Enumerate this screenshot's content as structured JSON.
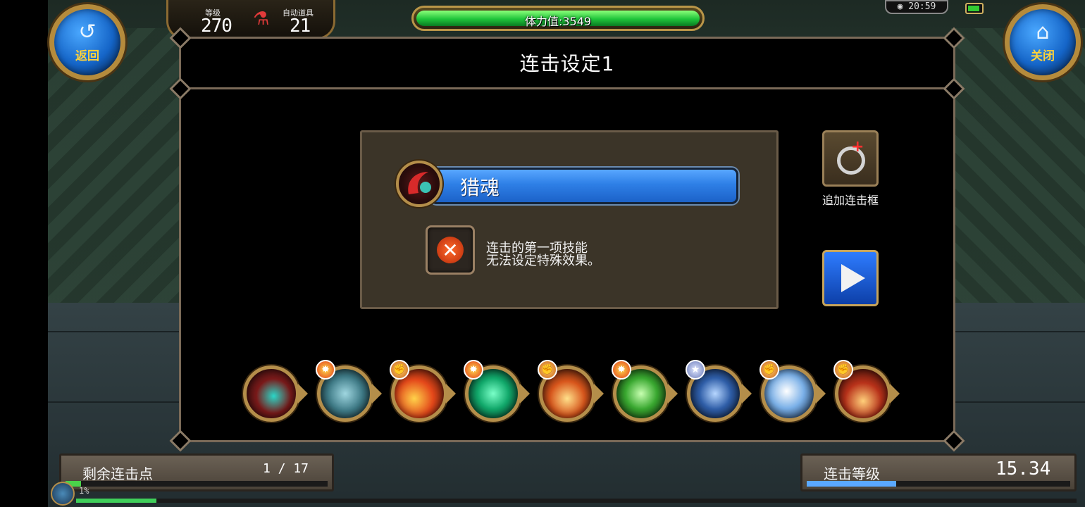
{
  "hud": {
    "back_label": "返回",
    "close_label": "关闭",
    "level_label": "等级",
    "level_value": "270",
    "auto_item_label": "自动道具",
    "auto_item_value": "21",
    "stamina_text": "体力值:3549",
    "stamina_fraction": 1.0,
    "clock": "20:59"
  },
  "dialog": {
    "title": "连击设定1",
    "selected_skill_name": "猎魂",
    "note_line1": "连击的第一项技能",
    "note_line2": "无法设定特殊效果。",
    "add_chain_label": "追加连击框"
  },
  "skills": [
    {
      "icon": "red-scythe-icon",
      "badge": null
    },
    {
      "icon": "wind-spirit-icon",
      "badge": "burst"
    },
    {
      "icon": "fire-slash-icon",
      "badge": "fist"
    },
    {
      "icon": "green-slash-icon",
      "badge": "burst"
    },
    {
      "icon": "fire-burst-icon",
      "badge": "fist"
    },
    {
      "icon": "green-shield-icon",
      "badge": "burst"
    },
    {
      "icon": "sword-icon",
      "badge": "star"
    },
    {
      "icon": "white-slash-icon",
      "badge": "fist"
    },
    {
      "icon": "red-dome-icon",
      "badge": "fist"
    }
  ],
  "footer": {
    "remaining_label": "剩余连击点",
    "remaining_value": "1 / 17",
    "remaining_fraction": 0.06,
    "chain_level_label": "连击等级",
    "chain_level_value": "15.34",
    "chain_level_fraction": 0.34,
    "exp_percent_text": "1%"
  },
  "colors": {
    "accent_blue": "#2e7fe6",
    "gold_frame": "#b48e4a",
    "stamina_green": "#1fc43a"
  }
}
